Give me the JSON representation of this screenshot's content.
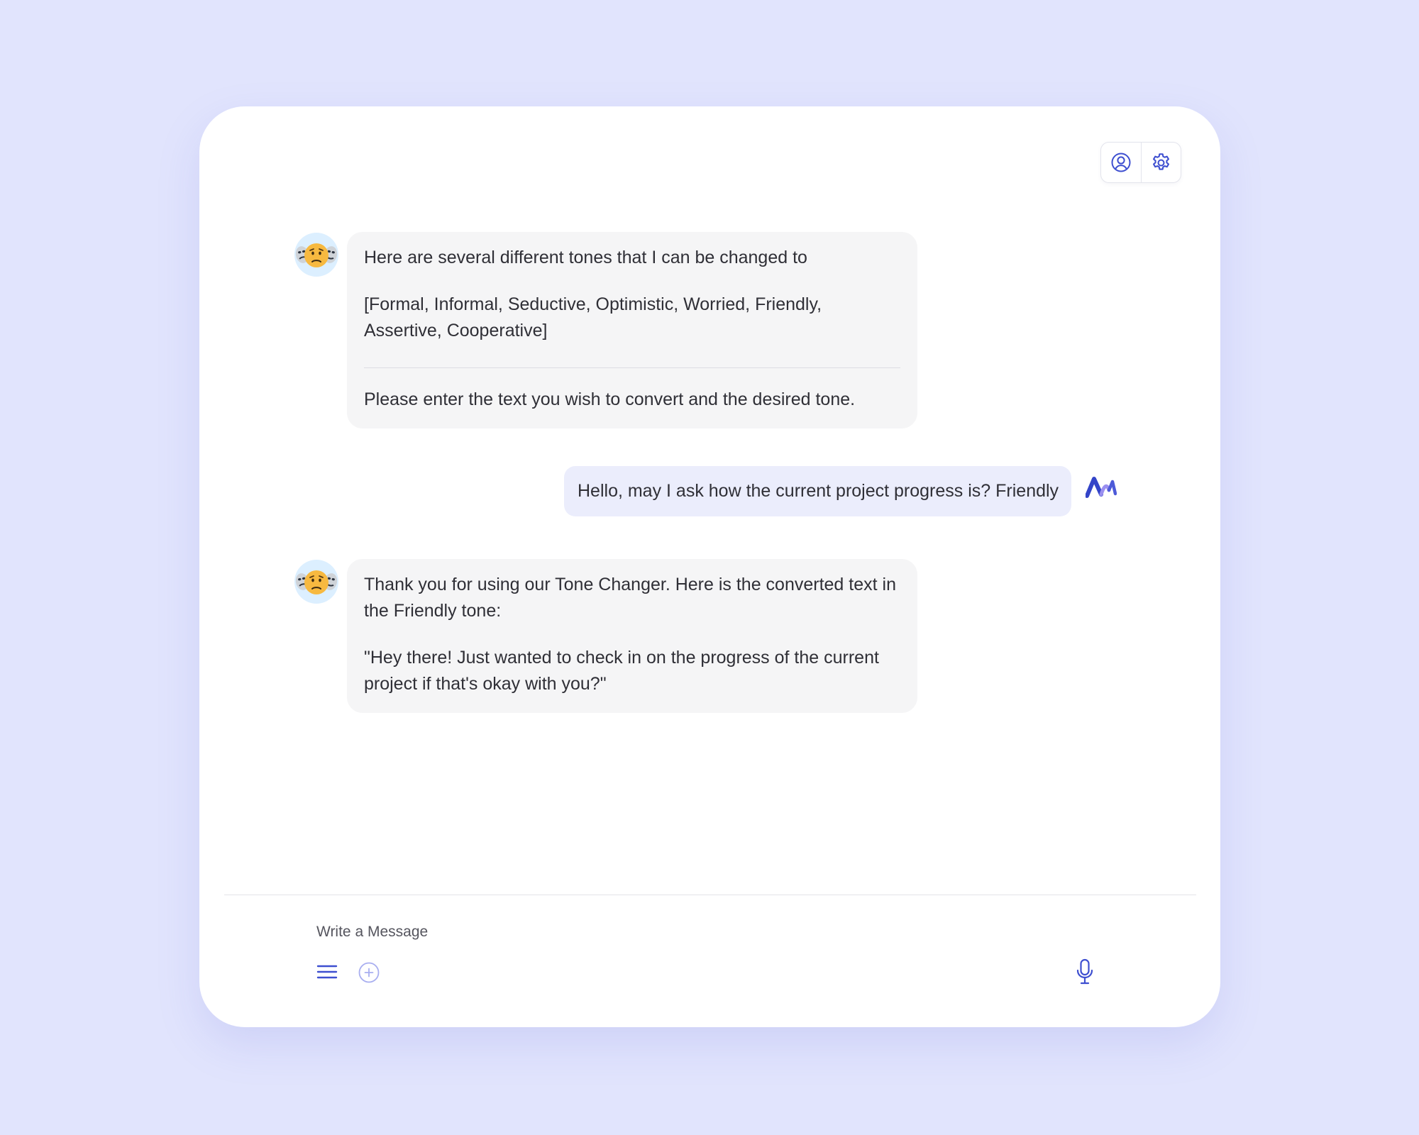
{
  "header": {
    "profile_icon": "user-circle-icon",
    "settings_icon": "gear-icon"
  },
  "messages": [
    {
      "role": "assistant",
      "avatar_icon": "masks-emoji-icon",
      "intro": "Here are several different tones that I can be changed to",
      "tones": "[Formal, Informal, Seductive, Optimistic, Worried, Friendly, Assertive, Cooperative]",
      "prompt": "Please enter the text you wish to convert and the desired tone."
    },
    {
      "role": "user",
      "avatar_icon": "brand-wave-logo-icon",
      "text": "Hello, may I ask how the current project progress is? Friendly"
    },
    {
      "role": "assistant",
      "avatar_icon": "masks-emoji-icon",
      "intro": "Thank you for using our Tone Changer. Here is the converted text in the Friendly tone:",
      "result": "\"Hey there! Just wanted to check in on the progress of the current project if that's okay with you?\""
    }
  ],
  "composer": {
    "placeholder": "Write a Message",
    "value": "",
    "menu_icon": "hamburger-menu-icon",
    "add_icon": "plus-circle-icon",
    "mic_icon": "microphone-icon"
  },
  "colors": {
    "background": "#e1e4fd",
    "card": "#ffffff",
    "accent": "#3e4fd0",
    "bot_bubble": "#f5f5f6",
    "user_bubble": "#ebedfc"
  }
}
